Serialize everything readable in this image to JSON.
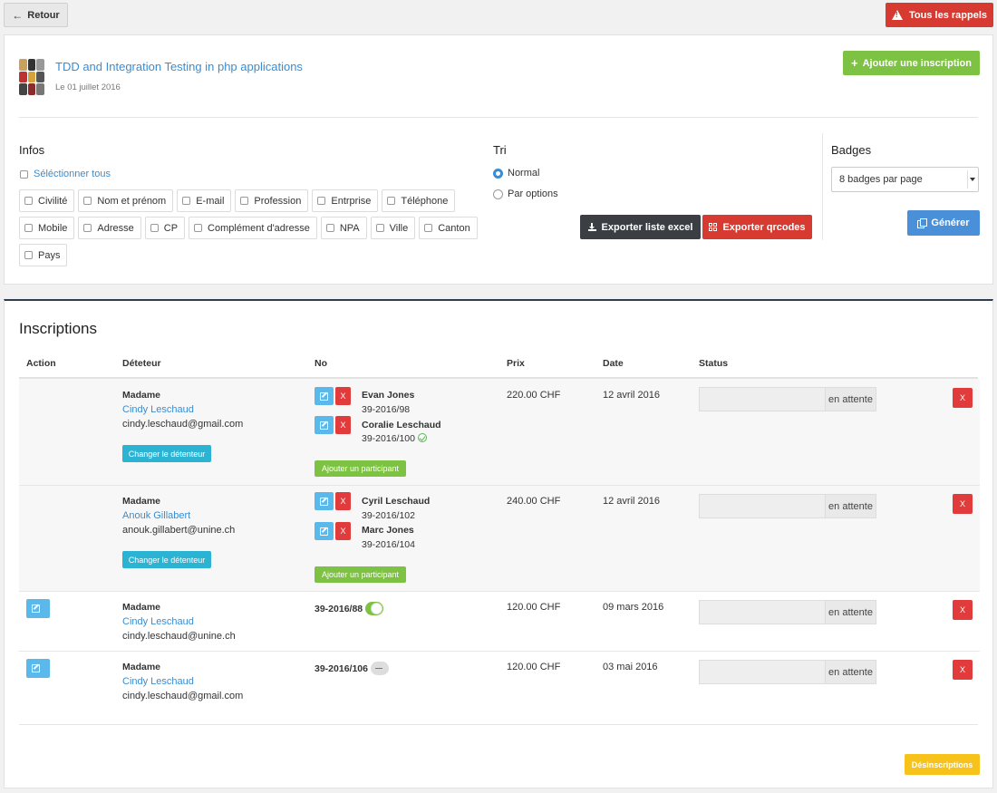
{
  "topbar": {
    "back_label": "Retour",
    "rappels_label": "Tous les rappels"
  },
  "colloque": {
    "title": "TDD and Integration Testing in php applications",
    "date": "Le 01 juillet 2016",
    "add_label": "Ajouter une inscription"
  },
  "infos": {
    "heading": "Infos",
    "select_all": "Séléctionner tous",
    "row1": [
      "Civilité",
      "Nom et prénom",
      "E-mail",
      "Profession",
      "Entrprise",
      "Téléphone"
    ],
    "row2": [
      "Mobile",
      "Adresse",
      "CP",
      "Complément d'adresse",
      "NPA",
      "Ville",
      "Canton"
    ],
    "row3": [
      "Pays"
    ]
  },
  "tri": {
    "heading": "Tri",
    "options": [
      "Normal",
      "Par options"
    ],
    "selected": "Normal",
    "export_excel": "Exporter liste excel",
    "export_qr": "Exporter qrcodes"
  },
  "badges": {
    "heading": "Badges",
    "select_value": "8 badges par page",
    "generate": "Générer"
  },
  "inscriptions": {
    "title": "Inscriptions",
    "columns": [
      "Action",
      "Déteteur",
      "No",
      "Prix",
      "Date",
      "Status"
    ],
    "change_holder": "Changer le détenteur",
    "add_participant": "Ajouter un participant",
    "delete_symbol": "X",
    "rows": [
      {
        "civilite": "Madame",
        "name": "Cindy Leschaud",
        "email": "cindy.leschaud@gmail.com",
        "participants": [
          {
            "name": "Evan Jones",
            "number": "39-2016/98",
            "checked": false
          },
          {
            "name": "Coralie Leschaud",
            "number": "39-2016/100",
            "checked": true
          }
        ],
        "price": "220.00 CHF",
        "date": "12 avril 2016",
        "status": "en attente"
      },
      {
        "civilite": "Madame",
        "name": "Anouk Gillabert",
        "email": "anouk.gillabert@unine.ch",
        "participants": [
          {
            "name": "Cyril Leschaud",
            "number": "39-2016/102",
            "checked": false
          },
          {
            "name": "Marc Jones",
            "number": "39-2016/104",
            "checked": false
          }
        ],
        "price": "240.00 CHF",
        "date": "12 avril 2016",
        "status": "en attente"
      },
      {
        "civilite": "Madame",
        "name": "Cindy Leschaud",
        "email": "cindy.leschaud@unine.ch",
        "number": "39-2016/88",
        "toggle": "on",
        "price": "120.00 CHF",
        "date": "09 mars 2016",
        "status": "en attente"
      },
      {
        "civilite": "Madame",
        "name": "Cindy Leschaud",
        "email": "cindy.leschaud@gmail.com",
        "number": "39-2016/106",
        "toggle": "off",
        "price": "120.00 CHF",
        "date": "03 mai 2016",
        "status": "en attente"
      }
    ],
    "unsubscribe_label": "Désinscriptions"
  },
  "colors": {
    "danger": "#d63a31",
    "success": "#7dc243",
    "primary": "#3b8cd0",
    "info": "#2bb3d4",
    "warning": "#f7c31a",
    "dark": "#3b3f44"
  }
}
